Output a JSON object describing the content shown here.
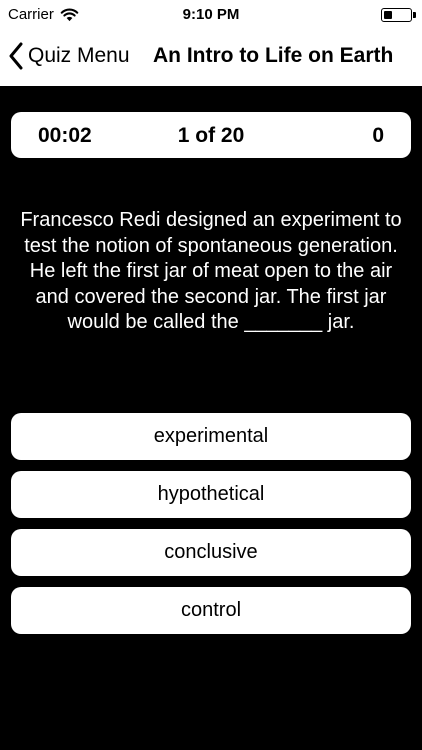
{
  "status_bar": {
    "carrier": "Carrier",
    "time": "9:10 PM",
    "wifi_icon": "wifi-icon",
    "battery_icon": "battery-icon"
  },
  "nav": {
    "back_label": "Quiz Menu",
    "back_icon": "chevron-left-icon",
    "title": "An Intro to Life on Earth"
  },
  "quiz": {
    "elapsed": "00:02",
    "progress": "1 of 20",
    "score": "0"
  },
  "question": "Francesco Redi designed an experiment to test the notion of spontaneous generation. He left the first jar of meat open to the air and covered the second jar. The first jar would be called the _______ jar.",
  "answers": [
    "experimental",
    "hypothetical",
    "conclusive",
    "control"
  ]
}
